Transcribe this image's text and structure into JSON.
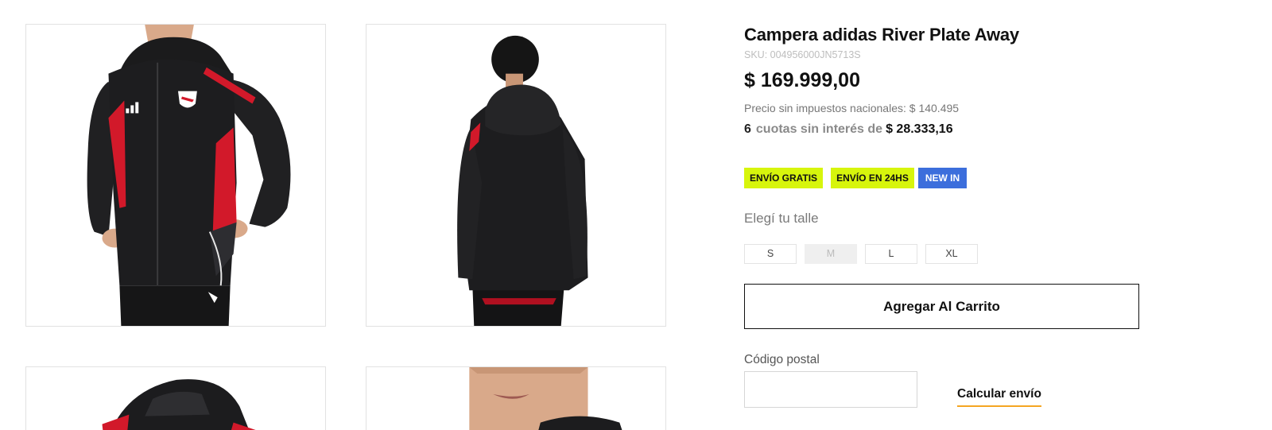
{
  "product": {
    "title": "Campera adidas River Plate Away",
    "sku": "SKU: 004956000JN5713S",
    "price": "$ 169.999,00",
    "net_price": "Precio sin impuestos nacionales: $ 140.495",
    "installments": {
      "count": "6",
      "text": "cuotas sin interés de",
      "amount": "$ 28.333,16"
    },
    "badges": [
      {
        "label": "ENVÍO GRATIS",
        "color": "#d7f50c"
      },
      {
        "label": "ENVÍO EN 24HS",
        "color": "#d7f50c"
      },
      {
        "label": "NEW IN",
        "color": "#3c6edc"
      }
    ]
  },
  "size_selector": {
    "label": "Elegí tu talle",
    "options": [
      {
        "label": "S",
        "available": true
      },
      {
        "label": "M",
        "available": false
      },
      {
        "label": "L",
        "available": true
      },
      {
        "label": "XL",
        "available": true
      }
    ]
  },
  "cart_button": {
    "label": "Agregar Al Carrito"
  },
  "shipping": {
    "label": "Código postal",
    "input_value": "",
    "calc_label": "Calcular envío",
    "accent_color": "#f5a623"
  },
  "gallery": {
    "images": [
      {
        "alt": "jacket-front-view"
      },
      {
        "alt": "jacket-back-view"
      },
      {
        "alt": "jacket-hood-detail"
      },
      {
        "alt": "jacket-collar-closeup"
      }
    ]
  },
  "colors": {
    "jacket": "#1c1c1e",
    "accent_red": "#d2192a"
  }
}
